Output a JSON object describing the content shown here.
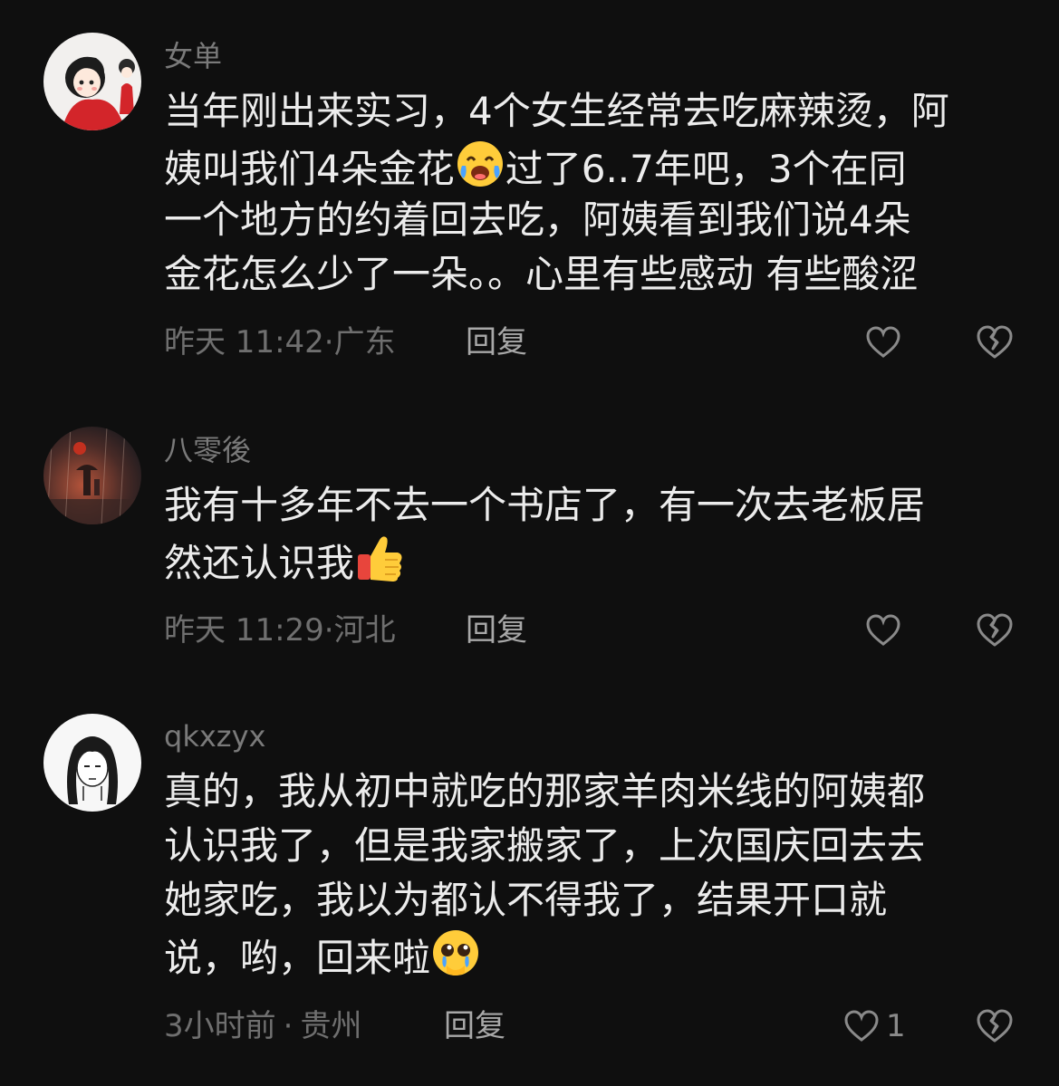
{
  "comments": [
    {
      "username": "女单",
      "avatar_icon": "avatar-girl-red-dress",
      "lines": [
        "当年刚出来实习，4个女生经常去吃麻辣烫，阿",
        "姨叫我们4朵金花",
        "一个地方的约着回去吃，阿姨看到我们说4朵",
        "金花怎么少了一朵。。心里有些感动 有些酸涩"
      ],
      "line2_after_emoji": "过了6..7年吧，3个在同",
      "emoji": "laughing-crying-emoji",
      "time": "昨天 11:42",
      "location": "广东",
      "reply_label": "回复",
      "like_count": ""
    },
    {
      "username": "八零後",
      "avatar_icon": "avatar-rainy-night-scene",
      "lines": [
        "我有十多年不去一个书店了，有一次去老板居",
        "然还认识我"
      ],
      "emoji": "thumbs-up-emoji",
      "time": "昨天 11:29",
      "location": "河北",
      "reply_label": "回复",
      "like_count": ""
    },
    {
      "username": "qkxzyx",
      "avatar_icon": "avatar-sketch-girl",
      "lines": [
        "真的，我从初中就吃的那家羊肉米线的阿姨都",
        "认识我了，但是我家搬家了，上次国庆回去去",
        "她家吃，我以为都认不得我了，结果开口就",
        "说，哟，回来啦"
      ],
      "emoji": "teary-eyed-emoji",
      "time": "3小时前",
      "location": "贵州",
      "reply_label": "回复",
      "like_count": "1"
    }
  ],
  "meta_separator": "·",
  "colors": {
    "background": "#0f0f0f",
    "text": "#ececec",
    "muted": "#6f6f6f",
    "username": "#7a7a7a"
  }
}
